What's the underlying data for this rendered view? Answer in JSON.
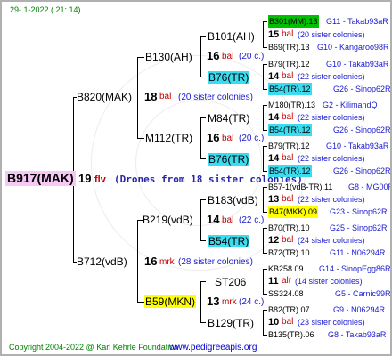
{
  "header": {
    "date_text": "29-   1-2022  ( 21:  14)"
  },
  "footer": {
    "copyright": "Copyright 2004-2022 @ Karl Kehrle Foundation",
    "site": "www.pedigreeapis.org"
  },
  "colors": {
    "root_bg": "#f6c8f4",
    "green_hl": "#00c000",
    "cyan_hl": "#3cdcf0",
    "yellow_hl": "#ffff00",
    "gray_hl": "#c8c8c8"
  },
  "root": {
    "name": "B917(MAK)",
    "num": "19",
    "abbr": "flv",
    "drones": "(Drones from 18 sister colonies)"
  },
  "gen1": [
    {
      "name": "B820(MAK)",
      "num": "18",
      "abbr": "bal",
      "sisters": "(20 sister colonies)"
    },
    {
      "name": "B712(vdB)",
      "num": "16",
      "abbr": "mrk",
      "sisters": "(28 sister colonies)"
    }
  ],
  "gen2": [
    {
      "name": "B130(AH)",
      "num": "16",
      "abbr": "bal",
      "sisters": "(20 c.)"
    },
    {
      "name": "M112(TR)",
      "num": "16",
      "abbr": "bal",
      "sisters": "(20 c.)"
    },
    {
      "name": "B219(vdB)",
      "num": "14",
      "abbr": "bal",
      "sisters": "(22 c.)"
    },
    {
      "name": "B59(MKN)",
      "num": "13",
      "abbr": "mrk",
      "sisters": "(24 c.)"
    }
  ],
  "gen3": [
    {
      "name": "B101(AH)",
      "num": "15",
      "abbr": "bal",
      "sisters": "(20 sister colonies)",
      "father": "B301(MM).13",
      "father_ref": "G11 - Takab93aR",
      "mother": "B69(TR).13",
      "mother_ref": "G10 - Kangaroo98R"
    },
    {
      "name": "B76(TR)",
      "num": "14",
      "abbr": "bal",
      "sisters": "(22 sister colonies)",
      "father": "B79(TR).12",
      "father_ref": "G10 - Takab93aR",
      "mother": "B54(TR).12",
      "mother_ref": "G26 - Sinop62R"
    },
    {
      "name": "M84(TR)",
      "num": "14",
      "abbr": "bal",
      "sisters": "(22 sister colonies)",
      "father": "M180(TR).13",
      "father_ref": "G2 - KilimandQ",
      "mother": "B54(TR).12",
      "mother_ref": "G26 - Sinop62R"
    },
    {
      "name": "B76(TR)",
      "num": "14",
      "abbr": "bal",
      "sisters": "(22 sister colonies)",
      "father": "B79(TR).12",
      "father_ref": "G10 - Takab93aR",
      "mother": "B54(TR).12",
      "mother_ref": "G26 - Sinop62R"
    },
    {
      "name": "B183(vdB)",
      "num": "13",
      "abbr": "bal",
      "sisters": "(22 sister colonies)",
      "father": "B57-1(vdB-TR).11",
      "father_ref": "G8 - MG00R",
      "mother": "B47(MKK).09",
      "mother_ref": "G23 - Sinop62R"
    },
    {
      "name": "B54(TR)",
      "num": "12",
      "abbr": "bal",
      "sisters": "(24 sister colonies)",
      "father": "B70(TR).10",
      "father_ref": "G25 - Sinop62R",
      "mother": "B72(TR).10",
      "mother_ref": "G11 - N06294R"
    },
    {
      "name": "ST206",
      "num": "11",
      "abbr": "alr",
      "sisters": "(14 sister colonies)",
      "father": "KB258.09",
      "father_ref": "G14 - SinopEgg86R",
      "mother": "SS324.08",
      "mother_ref": "G5 - Carnic99R"
    },
    {
      "name": "B129(TR)",
      "num": "10",
      "abbr": "bal",
      "sisters": "(23 sister colonies)",
      "father": "B82(TR).07",
      "father_ref": "G9 - N06294R",
      "mother": "B135(TR).06",
      "mother_ref": "G8 - Takab93aR"
    }
  ]
}
